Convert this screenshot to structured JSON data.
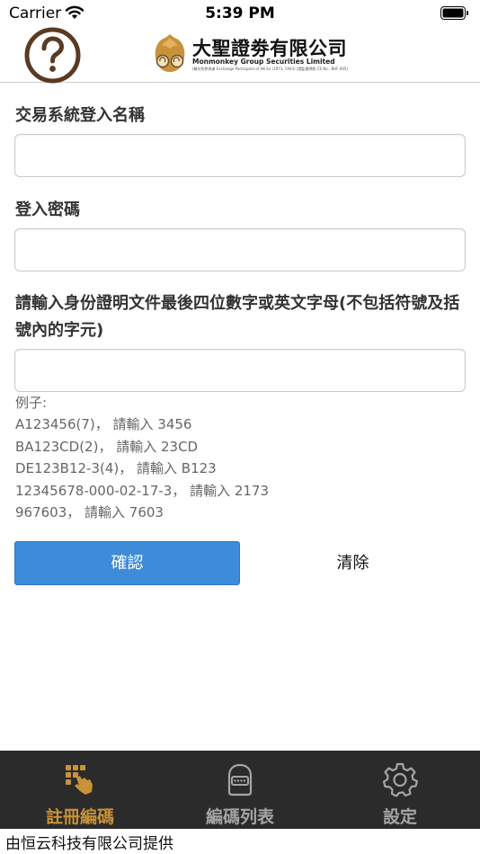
{
  "status_bar": {
    "carrier": "Carrier",
    "time": "5:39 PM"
  },
  "header": {
    "help_icon": "question-circle-icon",
    "brand_name": "大聖證劵有限公司",
    "brand_english": "Monmonkey Group Securities Limited",
    "brand_subtitle": "(聯交所參與者 Exchange Participant of HK Ex (1973, 1943) (證監會牌照 CE No.: BHF 605)"
  },
  "form": {
    "username_label": "交易系統登入名稱",
    "username_value": "",
    "password_label": "登入密碼",
    "password_value": "",
    "id_label": "請輸入身份證明文件最後四位數字或英文字母(不包括符號及括號內的字元)",
    "id_value": "",
    "examples": [
      "例子:",
      "A123456(7)， 請輸入 3456",
      "BA123CD(2)， 請輸入 23CD",
      "DE123B12-3(4)， 請輸入 B123",
      "12345678-000-02-17-3， 請輸入 2173",
      "967603， 請輸入 7603"
    ],
    "confirm_label": "確認",
    "clear_label": "清除"
  },
  "tabs": [
    {
      "label": "註冊編碼",
      "icon": "keypad-hand-icon",
      "active": true
    },
    {
      "label": "編碼列表",
      "icon": "token-device-icon",
      "active": false
    },
    {
      "label": "設定",
      "icon": "gear-icon",
      "active": false
    }
  ],
  "footer": {
    "credit": "由恒云科技有限公司提供"
  },
  "colors": {
    "accent": "#3d8bd9",
    "tab_active": "#c8923a",
    "tab_inactive": "#a5a5a5",
    "tab_bar_bg": "#2b2b2b",
    "help_icon": "#5a3a22"
  }
}
